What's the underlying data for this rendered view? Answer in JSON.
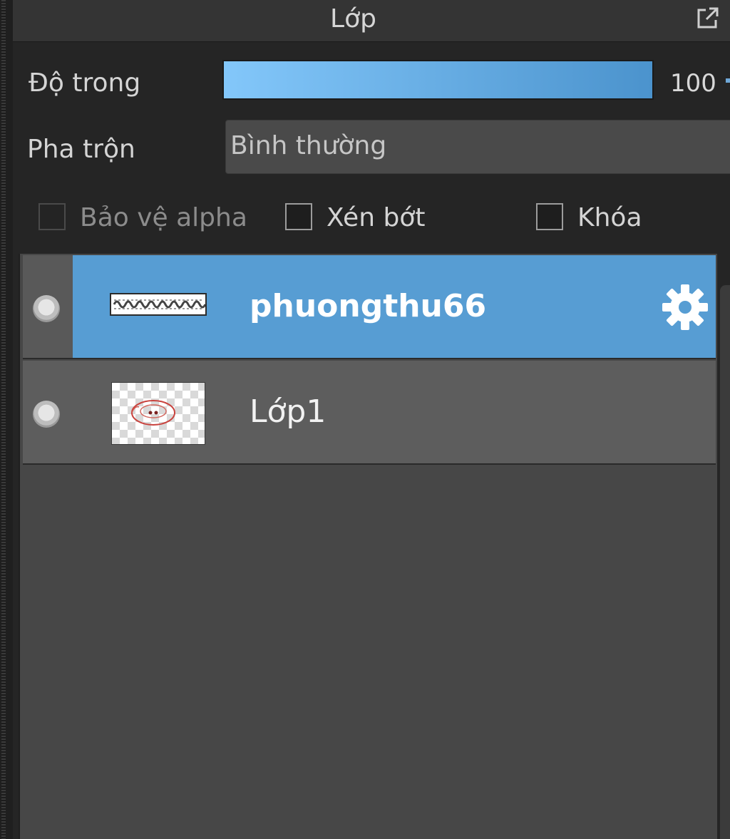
{
  "panel": {
    "title": "Lớp",
    "popout_icon": "popout-icon"
  },
  "opacity": {
    "label": "Độ trong",
    "value": "100",
    "percent": 100
  },
  "blend": {
    "label": "Pha trộn",
    "selected": "Bình thường"
  },
  "options": {
    "protect_alpha": "Bảo vệ alpha",
    "clipping": "Xén bớt",
    "lock": "Khóa"
  },
  "layers": [
    {
      "name": "phuongthu66",
      "selected": true,
      "settings_icon": "gear-icon"
    },
    {
      "name": "Lớp1",
      "selected": false
    }
  ],
  "colors": {
    "accent": "#579dd3",
    "slider_start": "#83c7fa",
    "slider_end": "#4b93cd"
  }
}
